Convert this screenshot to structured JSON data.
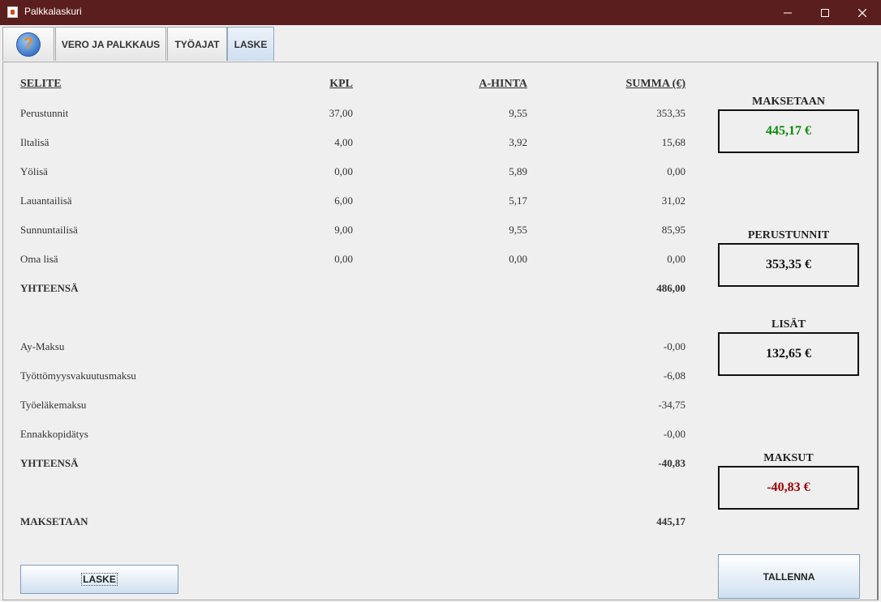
{
  "window": {
    "title": "Palkkalaskuri"
  },
  "tabs": {
    "vero": "VERO JA PALKKAUS",
    "tyoajat": "TYÖAJAT",
    "laske": "LASKE",
    "help": "?"
  },
  "headers": {
    "selite": "SELITE",
    "kpl": "KPL",
    "ahinta": "A-HINTA",
    "summa": "SUMMA (€)"
  },
  "rows": [
    {
      "label": "Perustunnit",
      "kpl": "37,00",
      "ahinta": "9,55",
      "summa": "353,35"
    },
    {
      "label": "Iltalisä",
      "kpl": "4,00",
      "ahinta": "3,92",
      "summa": "15,68"
    },
    {
      "label": "Yölisä",
      "kpl": "0,00",
      "ahinta": "5,89",
      "summa": "0,00"
    },
    {
      "label": "Lauantailisä",
      "kpl": "6,00",
      "ahinta": "5,17",
      "summa": "31,02"
    },
    {
      "label": "Sunnuntailisä",
      "kpl": "9,00",
      "ahinta": "9,55",
      "summa": "85,95"
    },
    {
      "label": "Oma lisä",
      "kpl": "0,00",
      "ahinta": "0,00",
      "summa": "0,00"
    }
  ],
  "total1": {
    "label": "YHTEENSÄ",
    "summa": "486,00"
  },
  "deductions": [
    {
      "label": "Ay-Maksu",
      "summa": "-0,00"
    },
    {
      "label": "Työttömyysvakuutusmaksu",
      "summa": "-6,08"
    },
    {
      "label": "Työeläkemaksu",
      "summa": "-34,75"
    },
    {
      "label": "Ennakkopidätys",
      "summa": "-0,00"
    }
  ],
  "total2": {
    "label": "YHTEENSÄ",
    "summa": "-40,83"
  },
  "payout": {
    "label": "MAKSETAAN",
    "summa": "445,17"
  },
  "summary": {
    "maksetaan": {
      "title": "MAKSETAAN",
      "value": "445,17 €"
    },
    "perustunnit": {
      "title": "PERUSTUNNIT",
      "value": "353,35 €"
    },
    "lisat": {
      "title": "LISÄT",
      "value": "132,65 €"
    },
    "maksut": {
      "title": "MAKSUT",
      "value": "-40,83 €"
    }
  },
  "buttons": {
    "laske": "LASKE",
    "tallenna": "TALLENNA"
  },
  "colors": {
    "titlebar": "#5b1e1e",
    "positive": "#0a8a0a",
    "negative": "#9b0000"
  }
}
